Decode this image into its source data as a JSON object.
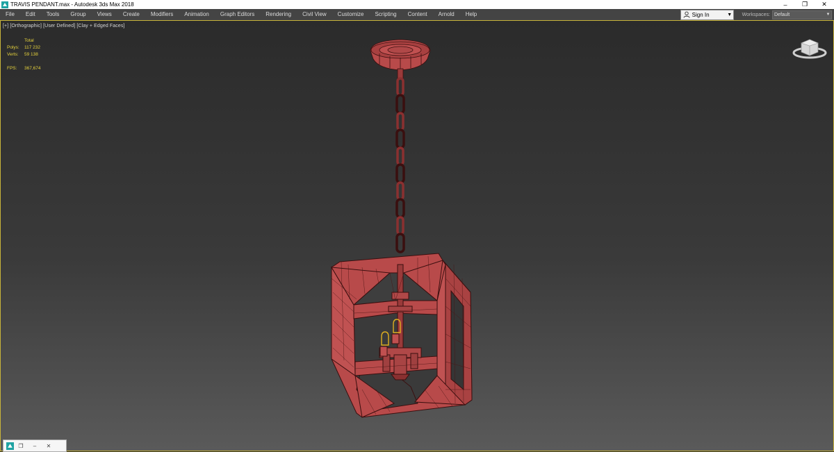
{
  "window": {
    "title": "TRAVIS PENDANT.max - Autodesk 3ds Max 2018",
    "controls": {
      "minimize": "–",
      "restore": "❐",
      "close": "✕"
    }
  },
  "menu": {
    "items": [
      "File",
      "Edit",
      "Tools",
      "Group",
      "Views",
      "Create",
      "Modifiers",
      "Animation",
      "Graph Editors",
      "Rendering",
      "Civil View",
      "Customize",
      "Scripting",
      "Content",
      "Arnold",
      "Help"
    ],
    "sign_in": "Sign In",
    "workspaces_label": "Workspaces:",
    "workspaces_value": "Default"
  },
  "viewport": {
    "label_parts": [
      "[+]",
      "[Orthographic]",
      "[User Defined]",
      "[Clay + Edged Faces]"
    ],
    "stats": {
      "header": "Total",
      "polys_label": "Polys:",
      "polys_value": "117 232",
      "verts_label": "Verts:",
      "verts_value": "59 138",
      "fps_label": "FPS:",
      "fps_value": "367,674"
    }
  },
  "colors": {
    "model": "#b84a4a",
    "wire": "#3a0f0f",
    "bulb": "#e0b020",
    "viewport_border": "#c8b43a",
    "stats_text": "#e6d23c"
  },
  "icons": {
    "app": "3ds-max-icon",
    "user": "user-icon",
    "viewcube": "viewcube-icon"
  }
}
